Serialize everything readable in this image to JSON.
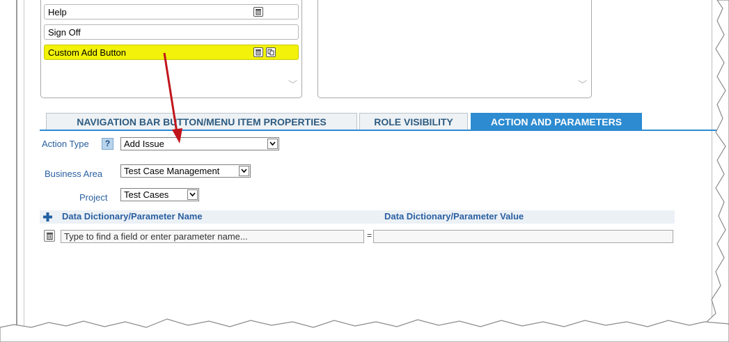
{
  "menu_items": [
    {
      "label": "Help",
      "selected": false,
      "icons": [
        "trash-icon"
      ]
    },
    {
      "label": "Sign Off",
      "selected": false,
      "icons": []
    },
    {
      "label": "Custom Add Button",
      "selected": true,
      "icons": [
        "trash-icon",
        "copy-icon"
      ]
    }
  ],
  "tabs": [
    {
      "label": "NAVIGATION BAR BUTTON/MENU ITEM PROPERTIES",
      "active": false
    },
    {
      "label": "ROLE VISIBILITY",
      "active": false
    },
    {
      "label": "ACTION AND PARAMETERS",
      "active": true
    }
  ],
  "form": {
    "action_type_label": "Action Type",
    "help_glyph": "?",
    "action_type_value": "Add Issue",
    "business_area_label": "Business Area",
    "business_area_value": "Test Case Management",
    "project_label": "Project",
    "project_value": "Test Cases"
  },
  "params": {
    "name_header": "Data Dictionary/Parameter Name",
    "value_header": "Data Dictionary/Parameter Value",
    "name_placeholder": "Type to find a field or enter parameter name...",
    "equals": "=",
    "value": ""
  },
  "colors": {
    "selected_item": "#f2f20a",
    "tab_active": "#2c8bd1",
    "tab_text": "#2e5b80",
    "label_blue": "#2a5fa0",
    "annotation_arrow": "#c0141b"
  }
}
